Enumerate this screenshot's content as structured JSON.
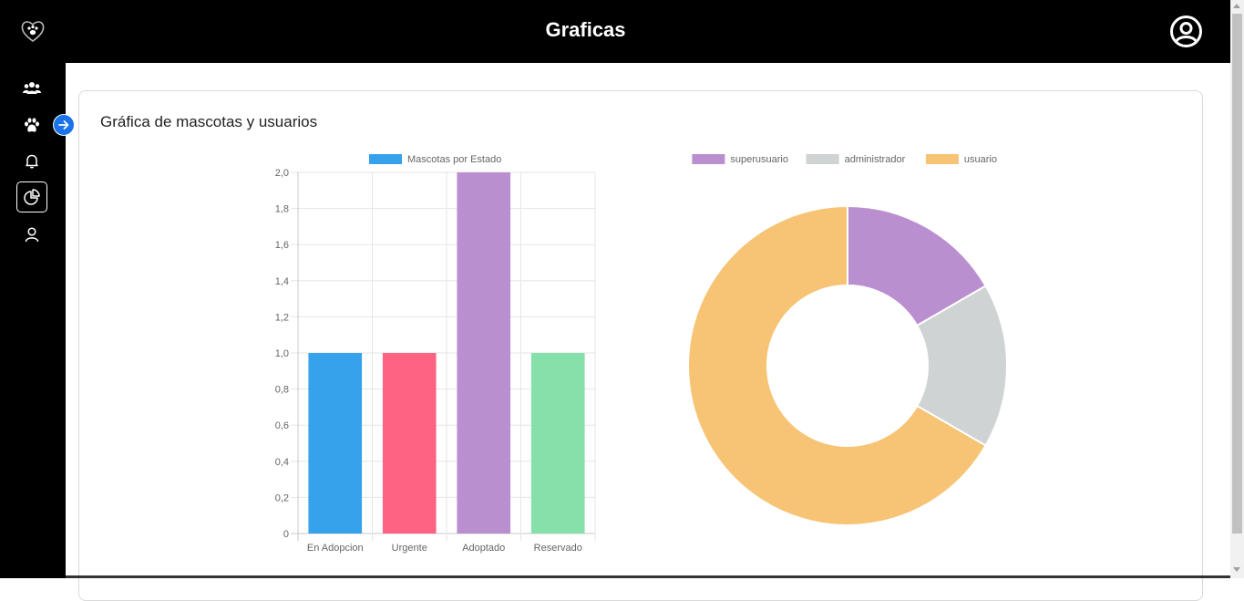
{
  "header": {
    "title": "Graficas"
  },
  "sidebar": {
    "items": [
      {
        "icon": "users-icon"
      },
      {
        "icon": "paw-icon"
      },
      {
        "icon": "bell-icon"
      },
      {
        "icon": "pie-chart-icon",
        "active": true
      },
      {
        "icon": "user-icon"
      }
    ]
  },
  "card": {
    "title": "Gráfica de mascotas y usuarios"
  },
  "bar_chart_ticks": [
    "0",
    "0,2",
    "0,4",
    "0,6",
    "0,8",
    "1,0",
    "1,2",
    "1,4",
    "1,6",
    "1,8",
    "2,0"
  ],
  "chart_data": [
    {
      "type": "bar",
      "categories": [
        "En Adopcion",
        "Urgente",
        "Adoptado",
        "Reservado"
      ],
      "series": [
        {
          "name": "Mascotas por Estado",
          "values": [
            1,
            1,
            2,
            1
          ]
        }
      ],
      "colors": [
        "#36a2eb",
        "#ff6384",
        "#ba8fcf",
        "#85e0aa"
      ],
      "legend_color": "#36a2eb",
      "ylim": [
        0,
        2
      ],
      "grid": true,
      "legend": "top"
    },
    {
      "type": "pie",
      "labels": [
        "superusuario",
        "administrador",
        "usuario"
      ],
      "values": [
        1,
        1,
        4
      ],
      "colors": [
        "#ba8fcf",
        "#cfd3d3",
        "#f7c475"
      ],
      "legend": "top"
    }
  ]
}
